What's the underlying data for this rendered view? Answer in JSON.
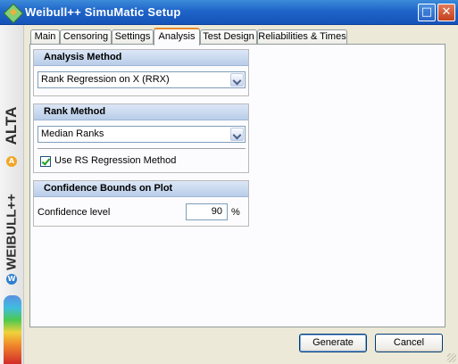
{
  "window": {
    "title": "Weibull++ SimuMatic Setup",
    "maximize_glyph": "□",
    "close_glyph": "✕"
  },
  "branding": {
    "top": "ALTA",
    "a_badge": "A",
    "middle": "WEIBULL++",
    "w_badge": "W"
  },
  "tabs": [
    {
      "label": "Main",
      "active": false
    },
    {
      "label": "Censoring",
      "active": false
    },
    {
      "label": "Settings",
      "active": false
    },
    {
      "label": "Analysis",
      "active": true
    },
    {
      "label": "Test Design",
      "active": false
    },
    {
      "label": "Reliabilities & Times",
      "active": false
    }
  ],
  "analysis_method": {
    "heading": "Analysis Method",
    "selected": "Rank Regression on X (RRX)"
  },
  "rank_method": {
    "heading": "Rank Method",
    "selected": "Median Ranks",
    "use_rs_label": "Use RS Regression Method",
    "use_rs_checked": true
  },
  "confidence_bounds": {
    "heading": "Confidence Bounds on Plot",
    "level_label": "Confidence level",
    "level_value": "90",
    "unit": "%"
  },
  "buttons": {
    "generate": "Generate",
    "cancel": "Cancel"
  },
  "icons": {
    "app": "weibull-app-icon",
    "dropdown": "chevron-down-icon",
    "check": "checkmark-icon"
  }
}
